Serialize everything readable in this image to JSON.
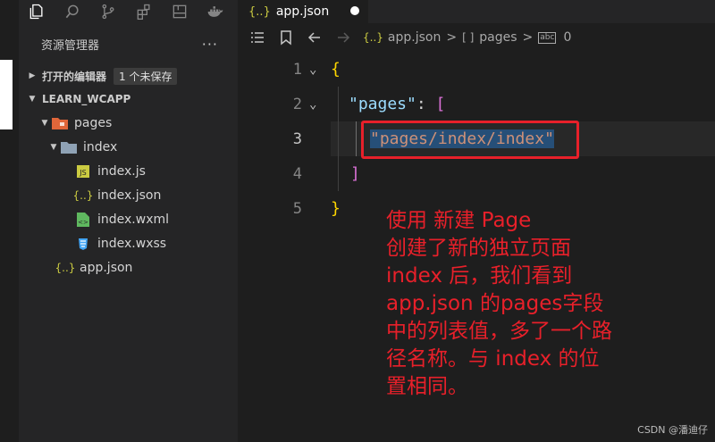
{
  "colors": {
    "accent_red": "#e8202a",
    "sidebar_bg": "#252526",
    "editor_bg": "#1e1e1e"
  },
  "activity_icons": [
    "explorer-icon",
    "search-icon",
    "source-control-icon",
    "extensions-icon",
    "file-icon",
    "docker-icon"
  ],
  "tab": {
    "title": "app.json",
    "icon": "{..}"
  },
  "breadcrumb": {
    "file": "app.json",
    "sep1": ">",
    "array_icon": "[ ]",
    "pages": "pages",
    "sep2": ">",
    "item_icon": "abc",
    "index": "0"
  },
  "sidebar": {
    "title": "资源管理器",
    "more": "···",
    "open_editors": {
      "label": "打开的编辑器",
      "badge": "1 个未保存"
    },
    "project": {
      "label": "LEARN_WCAPP"
    },
    "tree": {
      "pages": "pages",
      "index_folder": "index",
      "files": [
        "index.js",
        "index.json",
        "index.wxml",
        "index.wxss"
      ],
      "app_json": "app.json"
    }
  },
  "editor": {
    "line_numbers": [
      "1",
      "2",
      "3",
      "4",
      "5"
    ],
    "line1": "{",
    "line2_key": "\"pages\"",
    "line2_colon": ": ",
    "line2_bracket": "[",
    "line3_str": "\"pages/index/index\"",
    "line4_bracket": "]",
    "line5": "}"
  },
  "annotation": {
    "lines": [
      "使用 新建 Page",
      "创建了新的独立页面",
      "index 后，我们看到",
      "app.json 的pages字段",
      "中的列表值，多了一个路",
      "径名称。与 index 的位",
      "置相同。"
    ]
  },
  "watermark": "CSDN @潘迪仔"
}
